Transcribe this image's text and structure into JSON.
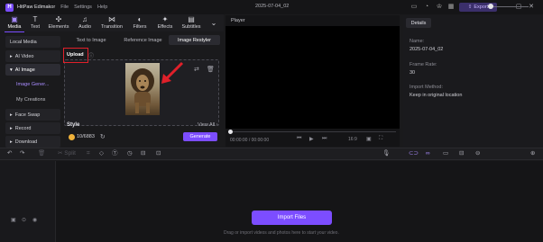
{
  "app": {
    "name": "HitPaw Edimakor",
    "menu": [
      "File",
      "Settings",
      "Help"
    ],
    "document_title": "2025-07-04_02",
    "export_label": "Export"
  },
  "toolbar": {
    "items": [
      {
        "label": "Media",
        "icon": "media-icon"
      },
      {
        "label": "Text",
        "icon": "text-icon"
      },
      {
        "label": "Elements",
        "icon": "elements-icon"
      },
      {
        "label": "Audio",
        "icon": "audio-icon"
      },
      {
        "label": "Transition",
        "icon": "transition-icon"
      },
      {
        "label": "Filters",
        "icon": "filters-icon"
      },
      {
        "label": "Effects",
        "icon": "effects-icon"
      },
      {
        "label": "Subtitles",
        "icon": "subtitles-icon"
      }
    ],
    "active": "Media"
  },
  "sidebar": {
    "items": [
      {
        "label": "Local Media"
      },
      {
        "label": "AI Video"
      },
      {
        "label": "AI Image"
      },
      {
        "label": "Face Swap"
      },
      {
        "label": "Record"
      },
      {
        "label": "Download"
      }
    ],
    "sub_items": [
      "Image Gener...",
      "My Creations"
    ]
  },
  "ai_image": {
    "tabs": [
      "Text to Image",
      "Reference Image",
      "Image Restyler"
    ],
    "active_tab": "Image Restyler",
    "upload_label": "Upload",
    "style_label": "Style",
    "view_all": "View All",
    "credits": "10/6883",
    "generate_label": "Generate",
    "highlight_color": "#e0202a"
  },
  "player": {
    "title": "Player",
    "time": "00:00:00 / 00:00:00",
    "ratio": "16:9"
  },
  "details": {
    "tab": "Details",
    "fields": [
      {
        "key": "Name:",
        "value": "2025-07-04_02"
      },
      {
        "key": "Frame Rate:",
        "value": "30"
      },
      {
        "key": "Import Method:",
        "value": "Keep in original location"
      }
    ]
  },
  "timeline": {
    "split_label": "Split",
    "import_label": "Import Files",
    "drag_hint": "Drag or import videos and photos here to start your video."
  },
  "colors": {
    "accent": "#7c4dff",
    "background": "#1a1a1c"
  }
}
